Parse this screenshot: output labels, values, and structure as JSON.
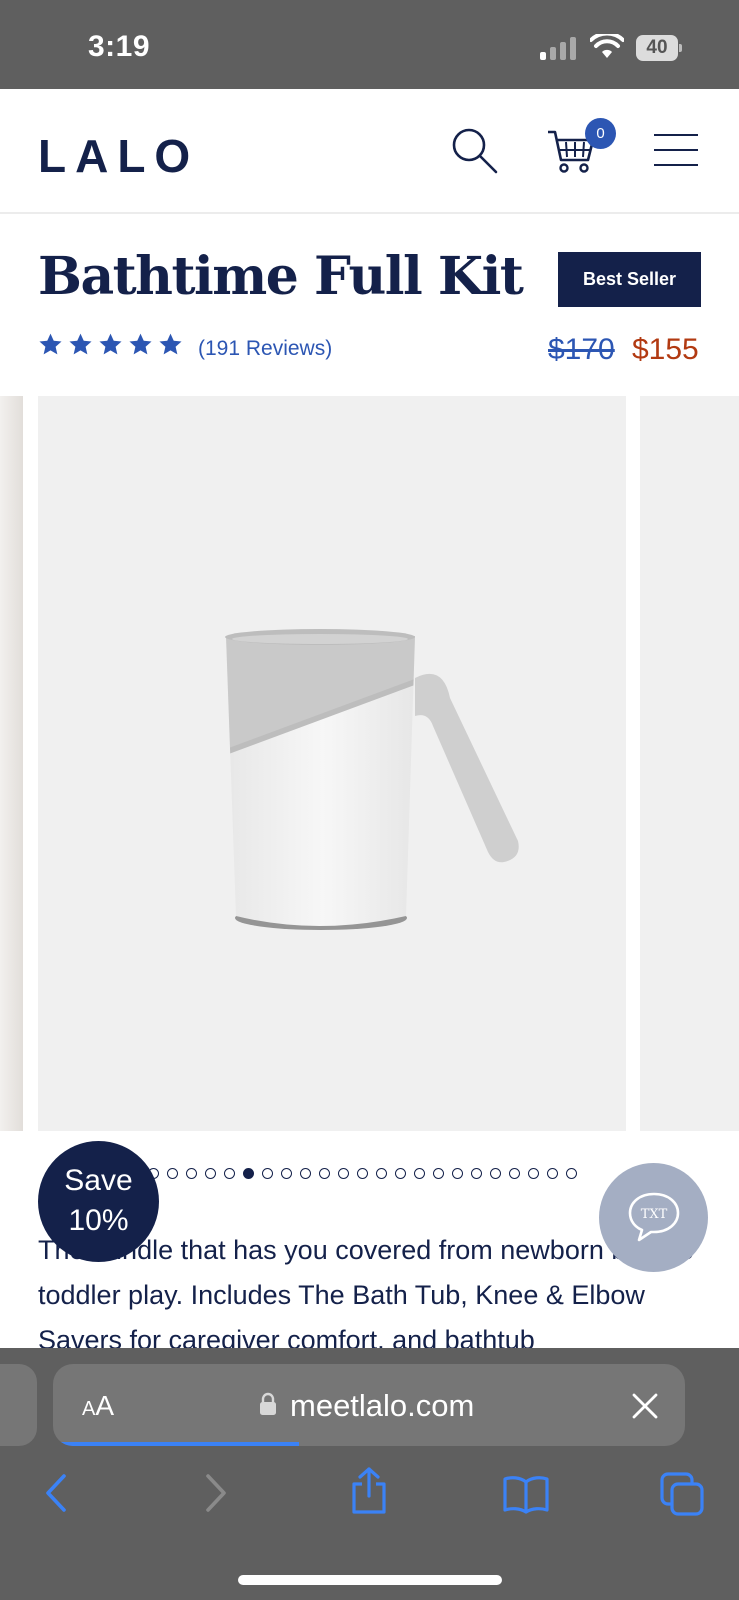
{
  "status_bar": {
    "time": "3:19",
    "battery": "40"
  },
  "header": {
    "logo": "LALO",
    "cart_count": "0"
  },
  "product": {
    "title": "Bathtime Full Kit",
    "badge": "Best Seller",
    "rating_stars": 5,
    "reviews": "(191 Reviews)",
    "price_old": "$170",
    "price_new": "$155"
  },
  "gallery": {
    "slide_count": 24,
    "active_index": 6,
    "visible_dots_from": 1
  },
  "description": "The bundle that has you covered from newborn bath to toddler play. Includes The Bath Tub, Knee & Elbow Savers for caregiver comfort, and bathtub",
  "promo": {
    "line1": "Save",
    "line2": "10%"
  },
  "chat": {
    "label": "TXT"
  },
  "browser": {
    "aa": "AA",
    "url": "meetlalo.com",
    "load_progress": 0.39
  },
  "colors": {
    "navy": "#14214a",
    "accent_blue": "#2c56b3",
    "sale_red": "#b23a12",
    "toolbar_gray": "#5f5f5f"
  }
}
